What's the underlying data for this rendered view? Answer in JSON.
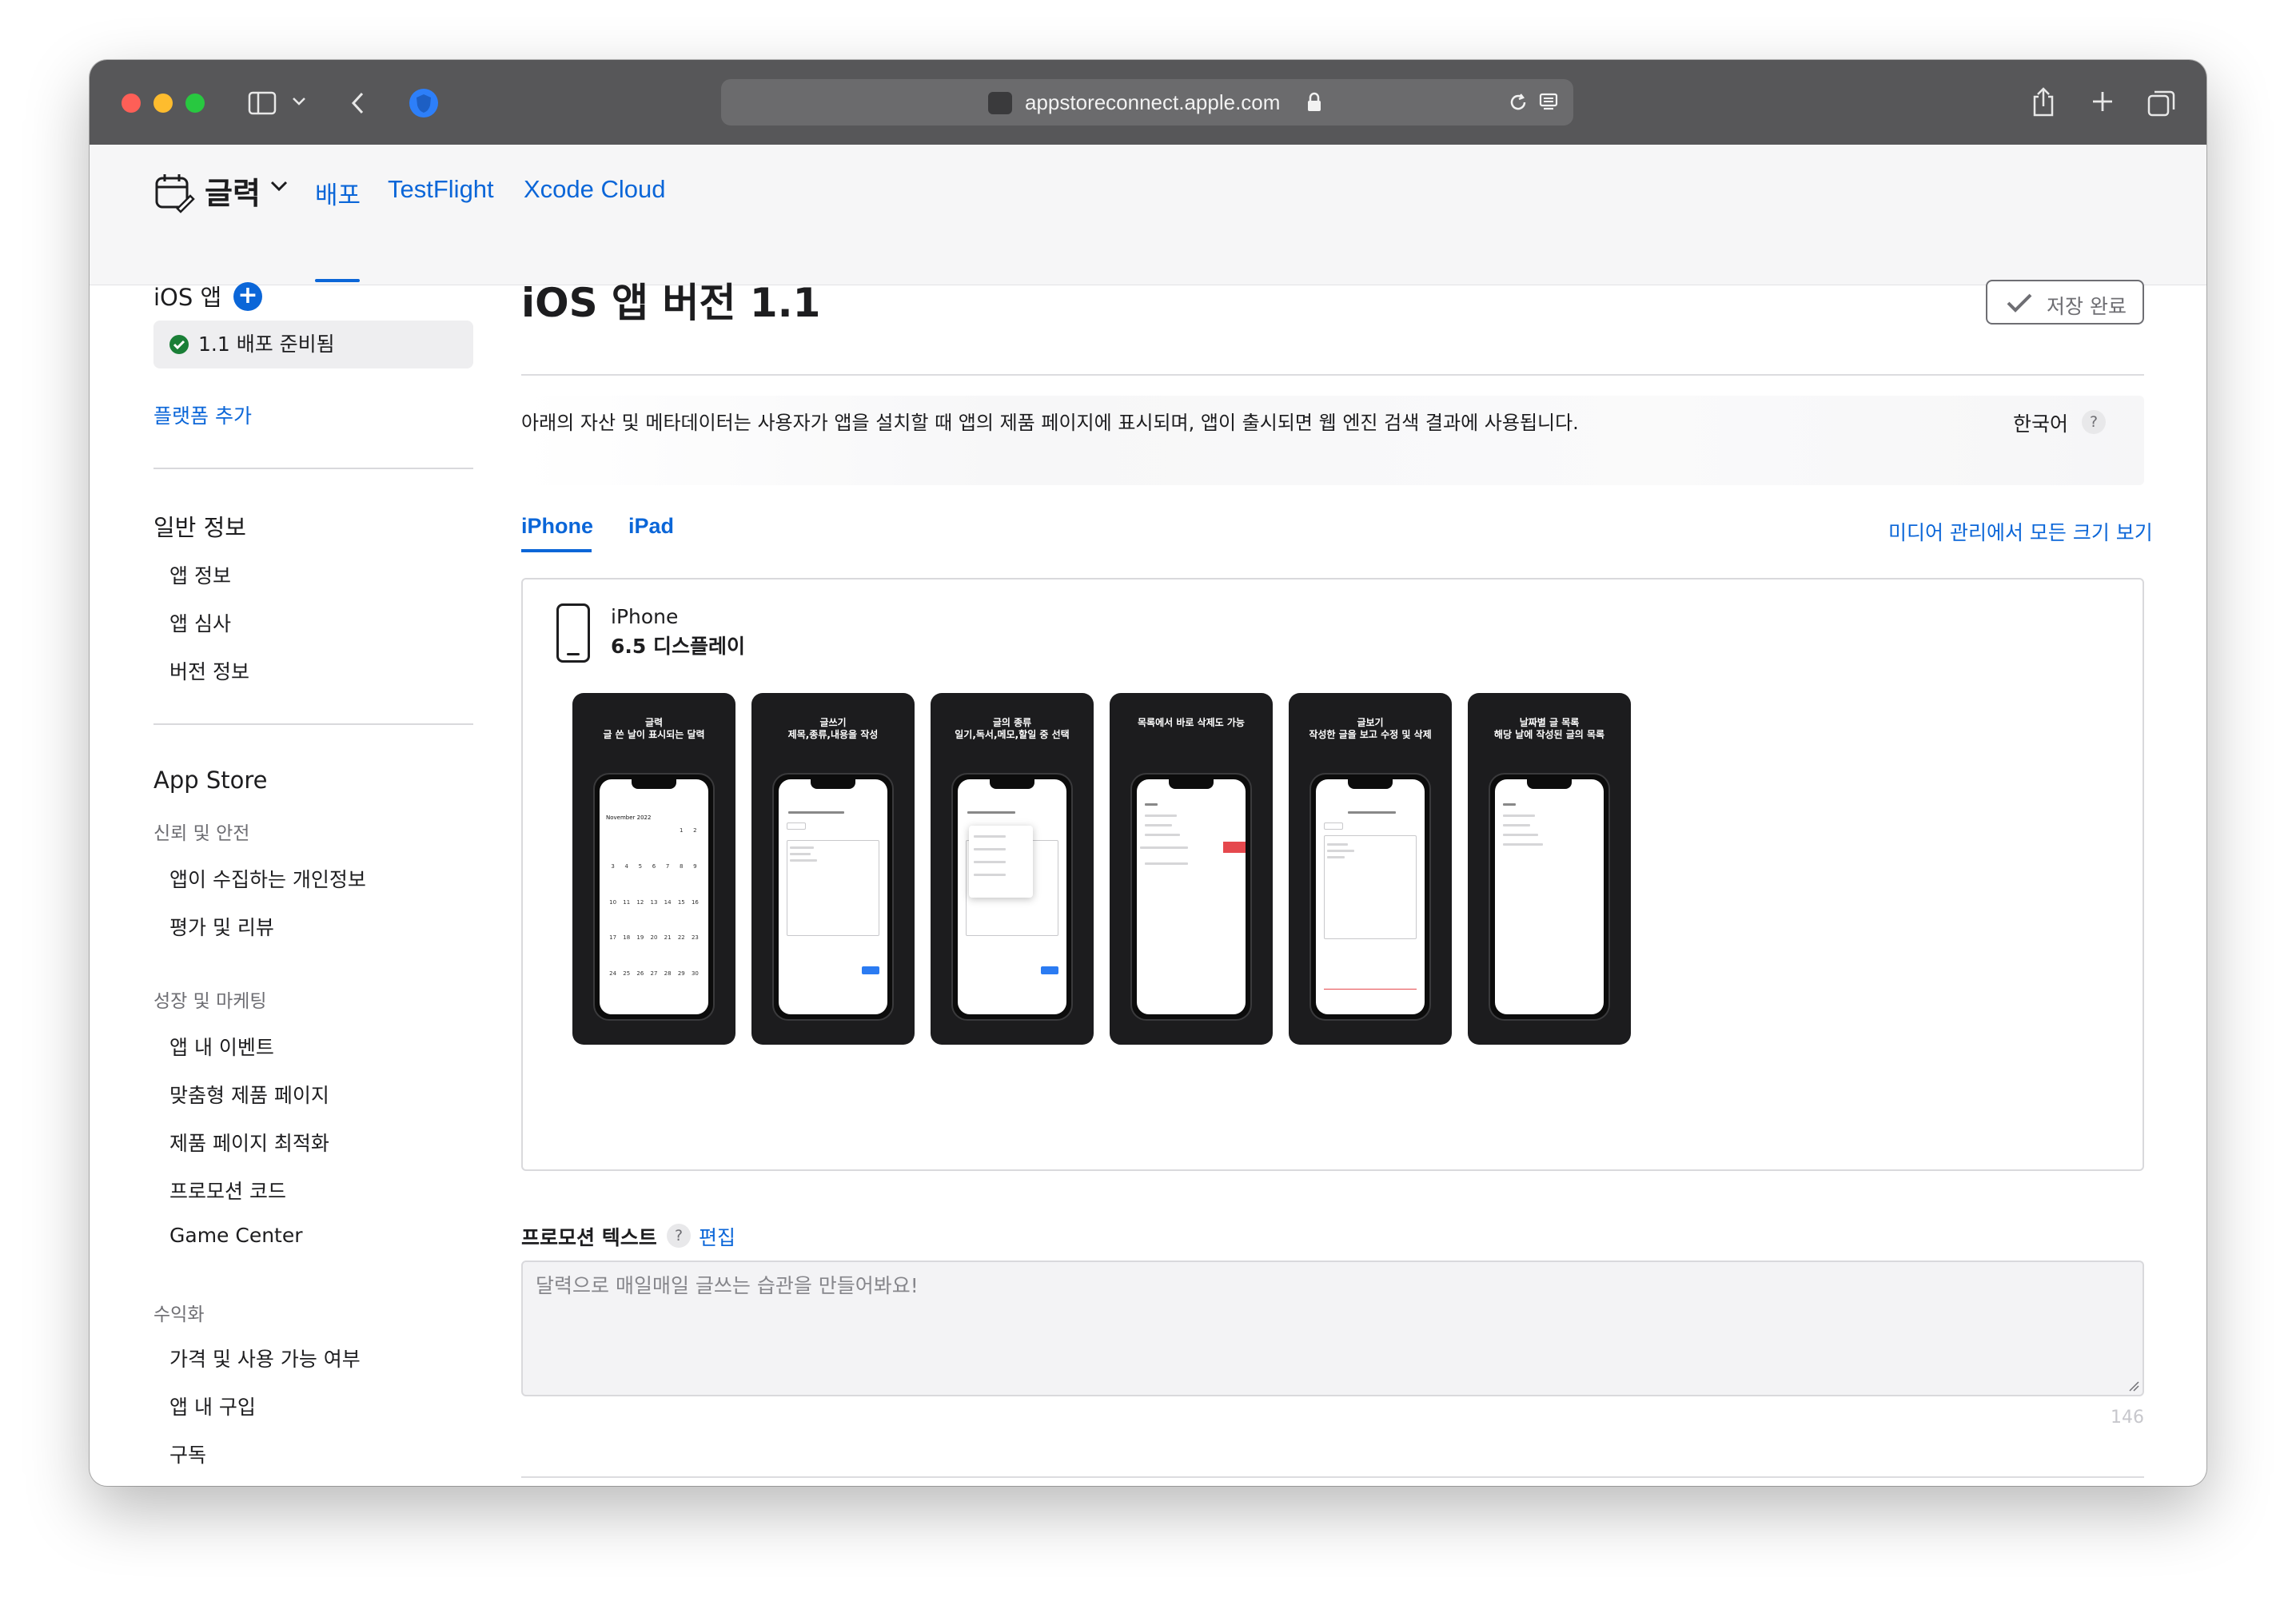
{
  "browser": {
    "url": "appstoreconnect.apple.com",
    "accent": "#575759"
  },
  "app": {
    "name": "글력",
    "tabs": [
      "배포",
      "TestFlight",
      "Xcode Cloud"
    ],
    "active_tab": "배포",
    "accent": "#0b66d8"
  },
  "sidebar": {
    "ios_app_heading": "iOS 앱",
    "version_status": "1.1 배포 준비됨",
    "add_platform": "플랫폼 추가",
    "general_heading": "일반 정보",
    "general_items": [
      "앱 정보",
      "앱 심사",
      "버전 정보"
    ],
    "appstore_heading": "App Store",
    "trust_category": "신뢰 및 안전",
    "trust_items": [
      "앱이 수집하는 개인정보",
      "평가 및 리뷰"
    ],
    "growth_category": "성장 및 마케팅",
    "growth_items": [
      "앱 내 이벤트",
      "맞춤형 제품 페이지",
      "제품 페이지 최적화",
      "프로모션 코드",
      "Game Center"
    ],
    "monetize_category": "수익화",
    "monetize_items": [
      "가격 및 사용 가능 여부",
      "앱 내 구입",
      "구독"
    ]
  },
  "main": {
    "title": "iOS 앱 버전 1.1",
    "save_label": "저장 완료",
    "description": "아래의 자산 및 메타데이터는 사용자가 앱을 설치할 때 앱의 제품 페이지에 표시되며, 앱이 출시되면 웹 엔진 검색 결과에 사용됩니다.",
    "language": "한국어",
    "help_glyph": "?",
    "device_tabs": [
      "iPhone",
      "iPad"
    ],
    "media_link": "미디어 관리에서 모든 크기 보기",
    "device_name": "iPhone",
    "device_size": "6.5 디스플레이",
    "screenshots": [
      {
        "line1": "글력",
        "line2": "글 쓴 날이 표시되는 달력",
        "screen": "calendar"
      },
      {
        "line1": "글쓰기",
        "line2": "제목,종류,내용을 작성",
        "screen": "editor"
      },
      {
        "line1": "글의 종류",
        "line2": "일기,독서,메모,할일 중 선택",
        "screen": "picker"
      },
      {
        "line1": "목록에서 바로 삭제도 가능",
        "line2": "",
        "screen": "delete"
      },
      {
        "line1": "글보기",
        "line2": "작성한 글을 보고 수정 및 삭제",
        "screen": "viewer"
      },
      {
        "line1": "날짜별 글 목록",
        "line2": "해당 날에 작성된 글의 목록",
        "screen": "list"
      }
    ],
    "calendar_month": "November 2022",
    "calendar_days": [
      "",
      "",
      "",
      "",
      "",
      "1",
      "2",
      "3",
      "4",
      "5",
      "6",
      "7",
      "8",
      "9",
      "10",
      "11",
      "12",
      "13",
      "14",
      "15",
      "16",
      "17",
      "18",
      "19",
      "20",
      "21",
      "22",
      "23",
      "24",
      "25",
      "26",
      "27",
      "28",
      "29",
      "30"
    ],
    "promo_label": "프로모션 텍스트",
    "promo_edit": "편집",
    "promo_text": "달력으로 매일매일 글쓰는 습관을 만들어봐요!",
    "promo_count": "146"
  }
}
